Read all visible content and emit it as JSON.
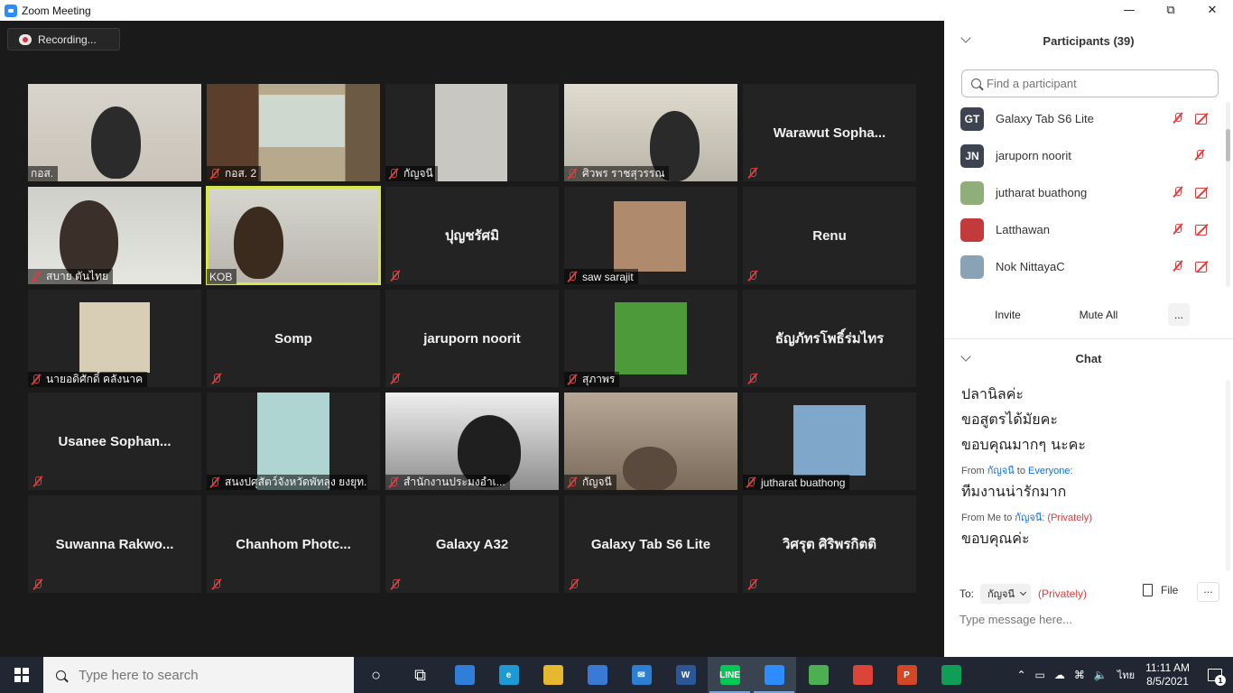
{
  "window": {
    "title": "Zoom Meeting",
    "controls": [
      "minimize",
      "restore",
      "close"
    ]
  },
  "recording": {
    "label": "Recording..."
  },
  "tiles": [
    {
      "kind": "video",
      "label": "กอส.",
      "muted": false,
      "active": false
    },
    {
      "kind": "video",
      "label": "กอส. 2",
      "muted": true,
      "active": false
    },
    {
      "kind": "video",
      "label": "กัญจนี",
      "muted": true,
      "active": false
    },
    {
      "kind": "video",
      "label": "ศิวพร ราชสุวรรณ",
      "muted": true,
      "active": false
    },
    {
      "kind": "name",
      "name": "Warawut  Sopha...",
      "muted": true
    },
    {
      "kind": "video",
      "label": "สบาย ตันไทย",
      "muted": true,
      "active": false
    },
    {
      "kind": "video",
      "label": "KOB",
      "muted": false,
      "active": true
    },
    {
      "kind": "name",
      "name": "ปุญชรัศมิ",
      "muted": true
    },
    {
      "kind": "video",
      "label": "saw sarajit",
      "muted": true,
      "active": false
    },
    {
      "kind": "name",
      "name": "Renu",
      "muted": true
    },
    {
      "kind": "video",
      "label": "นายอดิศักดิ์ คลังนาค",
      "muted": true,
      "active": false
    },
    {
      "kind": "name",
      "name": "Somp",
      "muted": true
    },
    {
      "kind": "name",
      "name": "jaruporn noorit",
      "muted": true
    },
    {
      "kind": "video",
      "label": "สุภาพร",
      "muted": true,
      "active": false
    },
    {
      "kind": "name",
      "name": "ธัญภัทรโพธิ์ร่มไทร",
      "muted": true
    },
    {
      "kind": "name",
      "name": "Usanee  Sophan...",
      "muted": true
    },
    {
      "kind": "video",
      "label": "สนงปศุสัตว์จังหวัดพัทลุง ยงยุท...",
      "muted": true,
      "active": false
    },
    {
      "kind": "video",
      "label": "สำนักงานประมงอำเ...",
      "muted": true,
      "active": false
    },
    {
      "kind": "video",
      "label": "กัญจนี",
      "muted": true,
      "active": false
    },
    {
      "kind": "video",
      "label": "jutharat buathong",
      "muted": true,
      "active": false
    },
    {
      "kind": "name",
      "name": "Suwanna  Rakwo...",
      "muted": true
    },
    {
      "kind": "name",
      "name": "Chanhom  Photc...",
      "muted": true
    },
    {
      "kind": "name",
      "name": "Galaxy A32",
      "muted": true
    },
    {
      "kind": "name",
      "name": "Galaxy Tab S6 Lite",
      "muted": true
    },
    {
      "kind": "name",
      "name": "วิศรุต ศิริพรกิตติ",
      "muted": true
    }
  ],
  "participants": {
    "title": "Participants (39)",
    "search_placeholder": "Find a participant",
    "items": [
      {
        "initials": "GT",
        "name": "Galaxy Tab S6 Lite",
        "avatar_color": "#3d4350",
        "mic_off": true,
        "cam_off": true
      },
      {
        "initials": "JN",
        "name": "jaruporn noorit",
        "avatar_color": "#3d4350",
        "mic_off": true,
        "cam_off": false
      },
      {
        "initials": "",
        "name": "jutharat buathong",
        "avatar_color": "#8fae7a",
        "mic_off": true,
        "cam_off": true
      },
      {
        "initials": "",
        "name": "Latthawan",
        "avatar_color": "#c23a3a",
        "mic_off": true,
        "cam_off": true
      },
      {
        "initials": "",
        "name": "Nok NittayaC",
        "avatar_color": "#8aa2b5",
        "mic_off": true,
        "cam_off": true
      }
    ],
    "buttons": {
      "invite": "Invite",
      "mute_all": "Mute All",
      "more": "..."
    }
  },
  "chat": {
    "title": "Chat",
    "messages": [
      {
        "from_prefix": "",
        "sender": "",
        "to_word": "",
        "recipient": "",
        "privately": "",
        "lines": [
          "ปลานิลค่ะ",
          "ขอสูตรได้มัยคะ",
          "ขอบคุณมากๆ นะคะ"
        ]
      },
      {
        "from_prefix": "From",
        "sender": "กัญจนี",
        "to_word": "to",
        "recipient": "Everyone:",
        "privately": "",
        "lines": [
          "ทีมงานน่ารักมาก"
        ]
      },
      {
        "from_prefix": "From Me to",
        "sender": "กัญจนี:",
        "to_word": "",
        "recipient": "",
        "privately": "(Privately)",
        "lines": [
          "ขอบคุณค่ะ"
        ]
      }
    ],
    "to_label": "To:",
    "to_recipient": "กัญจนี",
    "to_privately": "(Privately)",
    "file_label": "File",
    "more_label": "···",
    "input_placeholder": "Type message here..."
  },
  "taskbar": {
    "search_placeholder": "Type here to search",
    "apps": [
      {
        "name": "cortana-icon",
        "color": "transparent",
        "glyph": "○",
        "active": false
      },
      {
        "name": "task-view-icon",
        "color": "transparent",
        "glyph": "⧉",
        "active": false
      },
      {
        "name": "pc-icon",
        "color": "#2f7fd9",
        "glyph": "",
        "active": false
      },
      {
        "name": "edge-icon",
        "color": "#1b9ad6",
        "glyph": "e",
        "active": false
      },
      {
        "name": "file-explorer-icon",
        "color": "#e8b730",
        "glyph": "",
        "active": false
      },
      {
        "name": "store-icon",
        "color": "#3b79d6",
        "glyph": "",
        "active": false
      },
      {
        "name": "mail-icon",
        "color": "#2d7fd4",
        "glyph": "✉",
        "active": false
      },
      {
        "name": "word-icon",
        "color": "#2b5797",
        "glyph": "W",
        "active": false
      },
      {
        "name": "line-icon",
        "color": "#06c755",
        "glyph": "LINE",
        "active": true
      },
      {
        "name": "zoom-icon",
        "color": "#2d8cff",
        "glyph": "",
        "active": true
      },
      {
        "name": "android-icon",
        "color": "#4caf50",
        "glyph": "",
        "active": false
      },
      {
        "name": "chrome-icon",
        "color": "#db4437",
        "glyph": "",
        "active": false
      },
      {
        "name": "powerpoint-icon",
        "color": "#d24726",
        "glyph": "P",
        "active": false
      },
      {
        "name": "chrome-profile-icon",
        "color": "#0f9d58",
        "glyph": "",
        "active": false
      }
    ],
    "language": "ไทย",
    "time": "11:11 AM",
    "date": "8/5/2021",
    "notifications": "1"
  },
  "colors": {
    "active_speaker": "#d8e54d",
    "zoom_blue": "#2d8cff",
    "mute_red": "#e23b3b"
  }
}
